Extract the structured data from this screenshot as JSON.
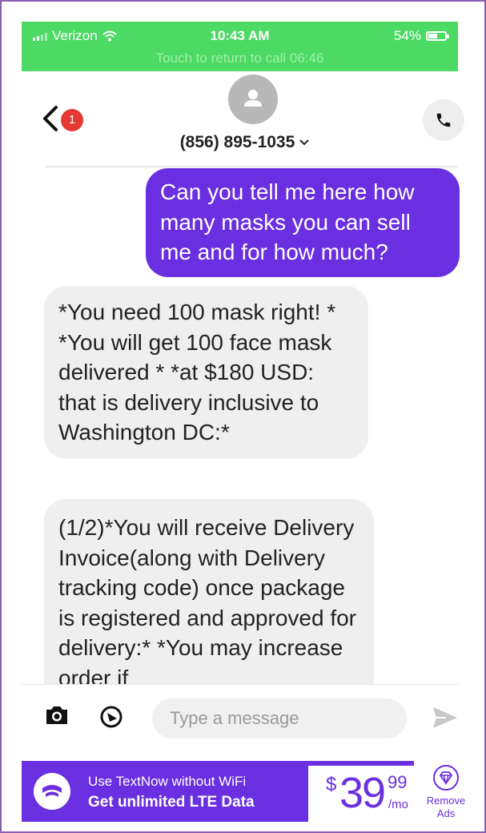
{
  "status_bar": {
    "carrier": "Verizon",
    "time": "10:43 AM",
    "battery": "54%",
    "battery_level": 0.54,
    "call_banner": "Touch to return to call 06:46"
  },
  "header": {
    "back_badge": "1",
    "contact": "(856) 895-1035"
  },
  "messages": [
    {
      "direction": "outgoing",
      "text": "Can you tell me here how many masks you can sell me and for how much?"
    },
    {
      "direction": "incoming",
      "text": "*You need 100 mask right! * *You will get 100 face mask delivered * *at $180 USD: that is delivery inclusive to Washington DC:*"
    },
    {
      "direction": "incoming",
      "text": "(1/2)*You will receive Delivery Invoice(along with Delivery tracking code) once package is registered and approved for delivery:* *You may increase order if"
    }
  ],
  "composer": {
    "placeholder": "Type a message"
  },
  "ad": {
    "line1": "Use TextNow without WiFi",
    "line2": "Get unlimited LTE Data",
    "currency": "$",
    "price": "39",
    "cents": "99",
    "period": "/mo",
    "remove_label": "Remove Ads"
  },
  "colors": {
    "status_green": "#4cd964",
    "accent_purple": "#6a2fe0",
    "incoming_bubble": "#efefef",
    "badge_red": "#e53935"
  }
}
